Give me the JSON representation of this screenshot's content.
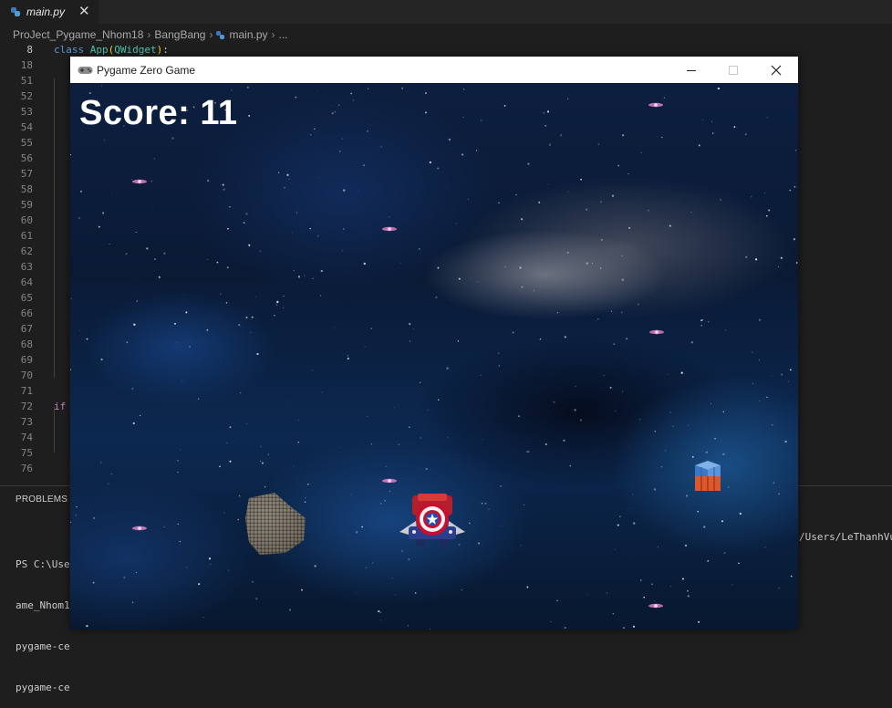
{
  "editor": {
    "tab": {
      "filename": "main.py",
      "close_glyph": "✕"
    },
    "breadcrumb": [
      "ProJect_Pygame_Nhom18",
      "BangBang",
      "main.py",
      "..."
    ],
    "breadcrumb_sep": "›",
    "lines": [
      {
        "num": "8",
        "kw": "class ",
        "cls": "App",
        "p1": "(",
        "base": "QWidget",
        "p2": ")",
        "rest": ":"
      },
      {
        "num": "18"
      },
      {
        "num": "51"
      },
      {
        "num": "52"
      },
      {
        "num": "53"
      },
      {
        "num": "54"
      },
      {
        "num": "55"
      },
      {
        "num": "56"
      },
      {
        "num": "57"
      },
      {
        "num": "58"
      },
      {
        "num": "59"
      },
      {
        "num": "60"
      },
      {
        "num": "61"
      },
      {
        "num": "62"
      },
      {
        "num": "63"
      },
      {
        "num": "64"
      },
      {
        "num": "65"
      },
      {
        "num": "66"
      },
      {
        "num": "67"
      },
      {
        "num": "68"
      },
      {
        "num": "69"
      },
      {
        "num": "70"
      },
      {
        "num": "71"
      },
      {
        "num": "72",
        "pink": "if"
      },
      {
        "num": "73"
      },
      {
        "num": "74"
      },
      {
        "num": "75"
      },
      {
        "num": "76"
      }
    ],
    "panel_title": "PROBLEMS",
    "terminal_left": [
      "PS C:\\User",
      "ame_Nhom1",
      "pygame-ce",
      "pygame-ce"
    ],
    "terminal_right": "/Users/LeThanhVu/"
  },
  "window": {
    "title": "Pygame Zero Game",
    "controls": {
      "minimize": "minimize",
      "maximize": "maximize",
      "close": "close"
    }
  },
  "game": {
    "score_label": "Score: 11",
    "sprites": [
      "asteroid",
      "player-spaceship",
      "supply-crate"
    ]
  },
  "colors": {
    "editor_bg": "#1e1e1e",
    "keyword": "#569cd6",
    "class": "#4ec9b0",
    "control": "#c586c0",
    "score_text": "#ffffff"
  }
}
